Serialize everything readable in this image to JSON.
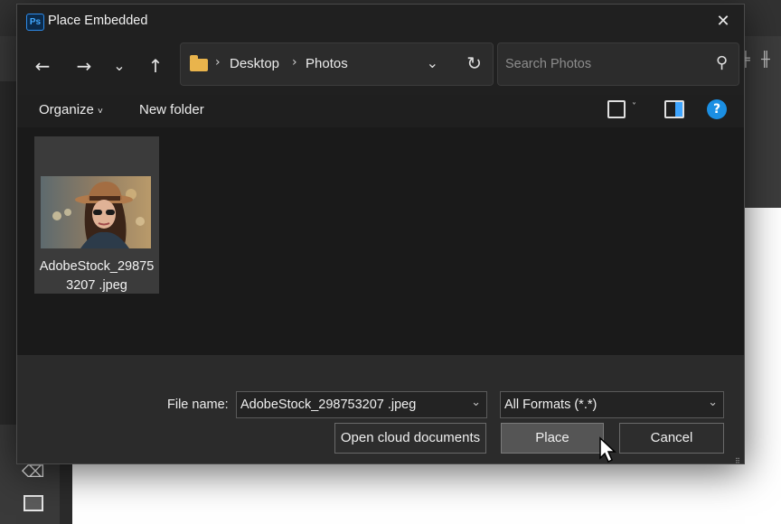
{
  "dialog": {
    "app_badge": "Ps",
    "title": "Place Embedded",
    "close_symbol": "✕"
  },
  "nav": {
    "back_symbol": "←",
    "forward_symbol": "→",
    "recent_symbol": "⌄",
    "up_symbol": "↑",
    "breadcrumb": [
      "Desktop",
      "Photos"
    ],
    "breadcrumb_sep": "›",
    "dropdown_symbol": "⌄",
    "refresh_symbol": "↻"
  },
  "search": {
    "placeholder": "Search Photos",
    "icon_symbol": "⚲"
  },
  "commandbar": {
    "organize": "Organize",
    "organize_caret": "˅",
    "new_folder": "New folder",
    "view_caret": "˅",
    "help_symbol": "?"
  },
  "files": [
    {
      "name": "AdobeStock_298753207 .jpeg",
      "icon": "image-thumbnail"
    }
  ],
  "footer": {
    "file_name_label": "File name:",
    "file_name_value": "AdobeStock_298753207 .jpeg",
    "format_value": "All Formats (*.*)",
    "dropdown_symbol": "⌄",
    "open_cloud_label": "Open cloud documents",
    "place_label": "Place",
    "cancel_label": "Cancel",
    "grip_symbol": "⠿"
  },
  "photoshop": {
    "right_icon_1": "╪",
    "right_icon_2": "╫",
    "eraser_symbol": "⌫"
  },
  "colors": {
    "accent": "#1b8fe3",
    "folder": "#e9b44c",
    "dialog_bg": "#1b1b1b",
    "footer_bg": "#2b2b2b"
  }
}
